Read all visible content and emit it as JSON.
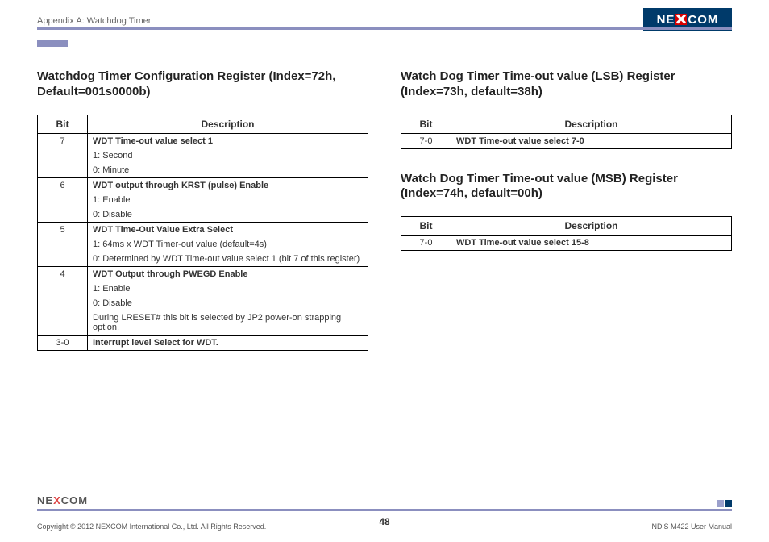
{
  "header": {
    "appendix": "Appendix A: Watchdog Timer",
    "logo_text_left": "NE",
    "logo_text_right": "COM"
  },
  "footer": {
    "logo": "NE",
    "logo_x": "X",
    "logo2": "COM",
    "copyright": "Copyright © 2012 NEXCOM International Co., Ltd. All Rights Reserved.",
    "page": "48",
    "manual": "NDiS M422 User Manual"
  },
  "left": {
    "title": "Watchdog Timer Configuration Register (Index=72h, Default=001s0000b)",
    "headers": {
      "bit": "Bit",
      "desc": "Description"
    },
    "rows": {
      "b7": {
        "bit": "7",
        "title": "WDT Time-out value select 1",
        "l1": "1: Second",
        "l2": "0: Minute"
      },
      "b6": {
        "bit": "6",
        "title": "WDT output through KRST (pulse) Enable",
        "l1": "1: Enable",
        "l2": "0: Disable"
      },
      "b5": {
        "bit": "5",
        "title": "WDT Time-Out Value Extra Select",
        "l1": "1: 64ms x WDT Timer-out value (default=4s)",
        "l2": "0: Determined by WDT Time-out value select 1 (bit 7 of this register)"
      },
      "b4": {
        "bit": "4",
        "title": "WDT Output through PWEGD Enable",
        "l1": "1: Enable",
        "l2": "0: Disable",
        "note": "During LRESET# this bit is selected by JP2 power-on strapping option."
      },
      "b30": {
        "bit": "3-0",
        "title": "Interrupt level Select for WDT."
      }
    }
  },
  "right": {
    "lsb": {
      "title": "Watch Dog Timer Time-out value (LSB) Register (Index=73h, default=38h)",
      "headers": {
        "bit": "Bit",
        "desc": "Description"
      },
      "row": {
        "bit": "7-0",
        "title": "WDT Time-out value select 7-0"
      }
    },
    "msb": {
      "title": "Watch Dog Timer Time-out value (MSB) Register (Index=74h, default=00h)",
      "headers": {
        "bit": "Bit",
        "desc": "Description"
      },
      "row": {
        "bit": "7-0",
        "title": "WDT Time-out value select 15-8"
      }
    }
  }
}
